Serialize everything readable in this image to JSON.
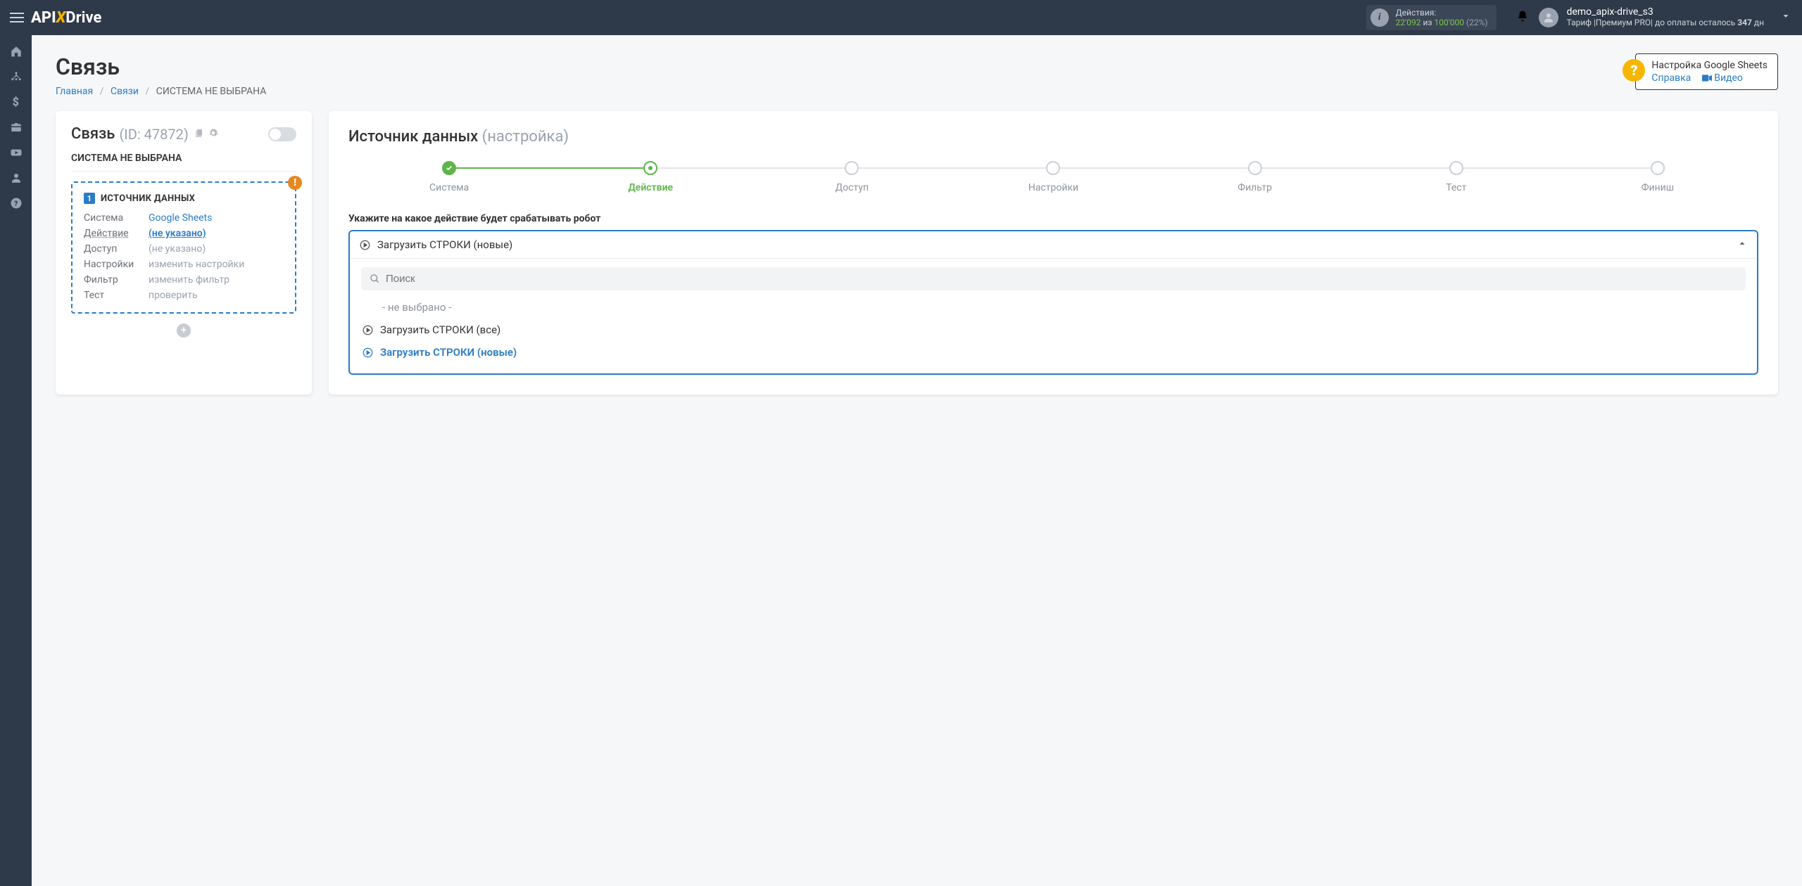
{
  "topbar": {
    "logo": {
      "pre": "API",
      "x": "X",
      "post": "Drive"
    },
    "actions": {
      "label": "Действия:",
      "used": "22'092",
      "of": "из",
      "total": "100'000",
      "pct": "(22%)"
    },
    "user": {
      "name": "demo_apix-drive_s3",
      "tariff_pre": "Тариф |Премиум PRO| до оплаты осталось ",
      "days": "347",
      "tariff_post": " дн"
    }
  },
  "page": {
    "title": "Связь",
    "crumbs": {
      "home": "Главная",
      "links": "Связи",
      "current": "СИСТЕМА НЕ ВЫБРАНА"
    }
  },
  "help": {
    "title": "Настройка Google Sheets",
    "ref": "Справка",
    "video": "Видео"
  },
  "leftcard": {
    "title": "Связь",
    "id": "(ID: 47872)",
    "sys_not": "СИСТЕМА НЕ ВЫБРАНА",
    "src_h": "ИСТОЧНИК ДАННЫХ",
    "rows": {
      "system": {
        "k": "Система",
        "v": "Google Sheets"
      },
      "action": {
        "k": "Действие",
        "v": "(не указано)"
      },
      "access": {
        "k": "Доступ",
        "v": "(не указано)"
      },
      "settings": {
        "k": "Настройки",
        "v": "изменить настройки"
      },
      "filter": {
        "k": "Фильтр",
        "v": "изменить фильтр"
      },
      "test": {
        "k": "Тест",
        "v": "проверить"
      }
    }
  },
  "rightcard": {
    "title": "Источник данных",
    "hint": "(настройка)",
    "steps": [
      "Система",
      "Действие",
      "Доступ",
      "Настройки",
      "Фильтр",
      "Тест",
      "Финиш"
    ],
    "prompt": "Укажите на какое действие будет срабатывать робот",
    "selected": "Загрузить СТРОКИ (новые)",
    "search_placeholder": "Поиск",
    "options": {
      "none": "- не выбрано -",
      "all": "Загрузить СТРОКИ (все)",
      "new": "Загрузить СТРОКИ (новые)"
    }
  }
}
